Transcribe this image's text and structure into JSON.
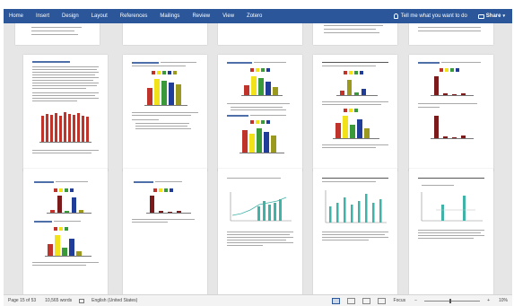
{
  "ribbon": {
    "tabs": [
      "Home",
      "Insert",
      "Design",
      "Layout",
      "References",
      "Mailings",
      "Review",
      "View",
      "Zotero"
    ],
    "tell_me": "Tell me what you want to do",
    "share": "Share"
  },
  "status": {
    "page": "Page 15 of 53",
    "words": "10,565 words",
    "language": "English (United States)",
    "focus": "Focus",
    "zoom_minus": "−",
    "zoom_plus": "+",
    "zoom": "10%"
  },
  "colors": {
    "ribbon": "#2b579a",
    "bar_red": "#c0332b",
    "bar_yellow": "#f2e21a",
    "bar_green": "#3a9a3a",
    "bar_blue": "#1f3d99",
    "bar_olive": "#9c9a1e",
    "bar_darkred": "#7a1a1a",
    "bar_teal": "#3fb3a8"
  }
}
